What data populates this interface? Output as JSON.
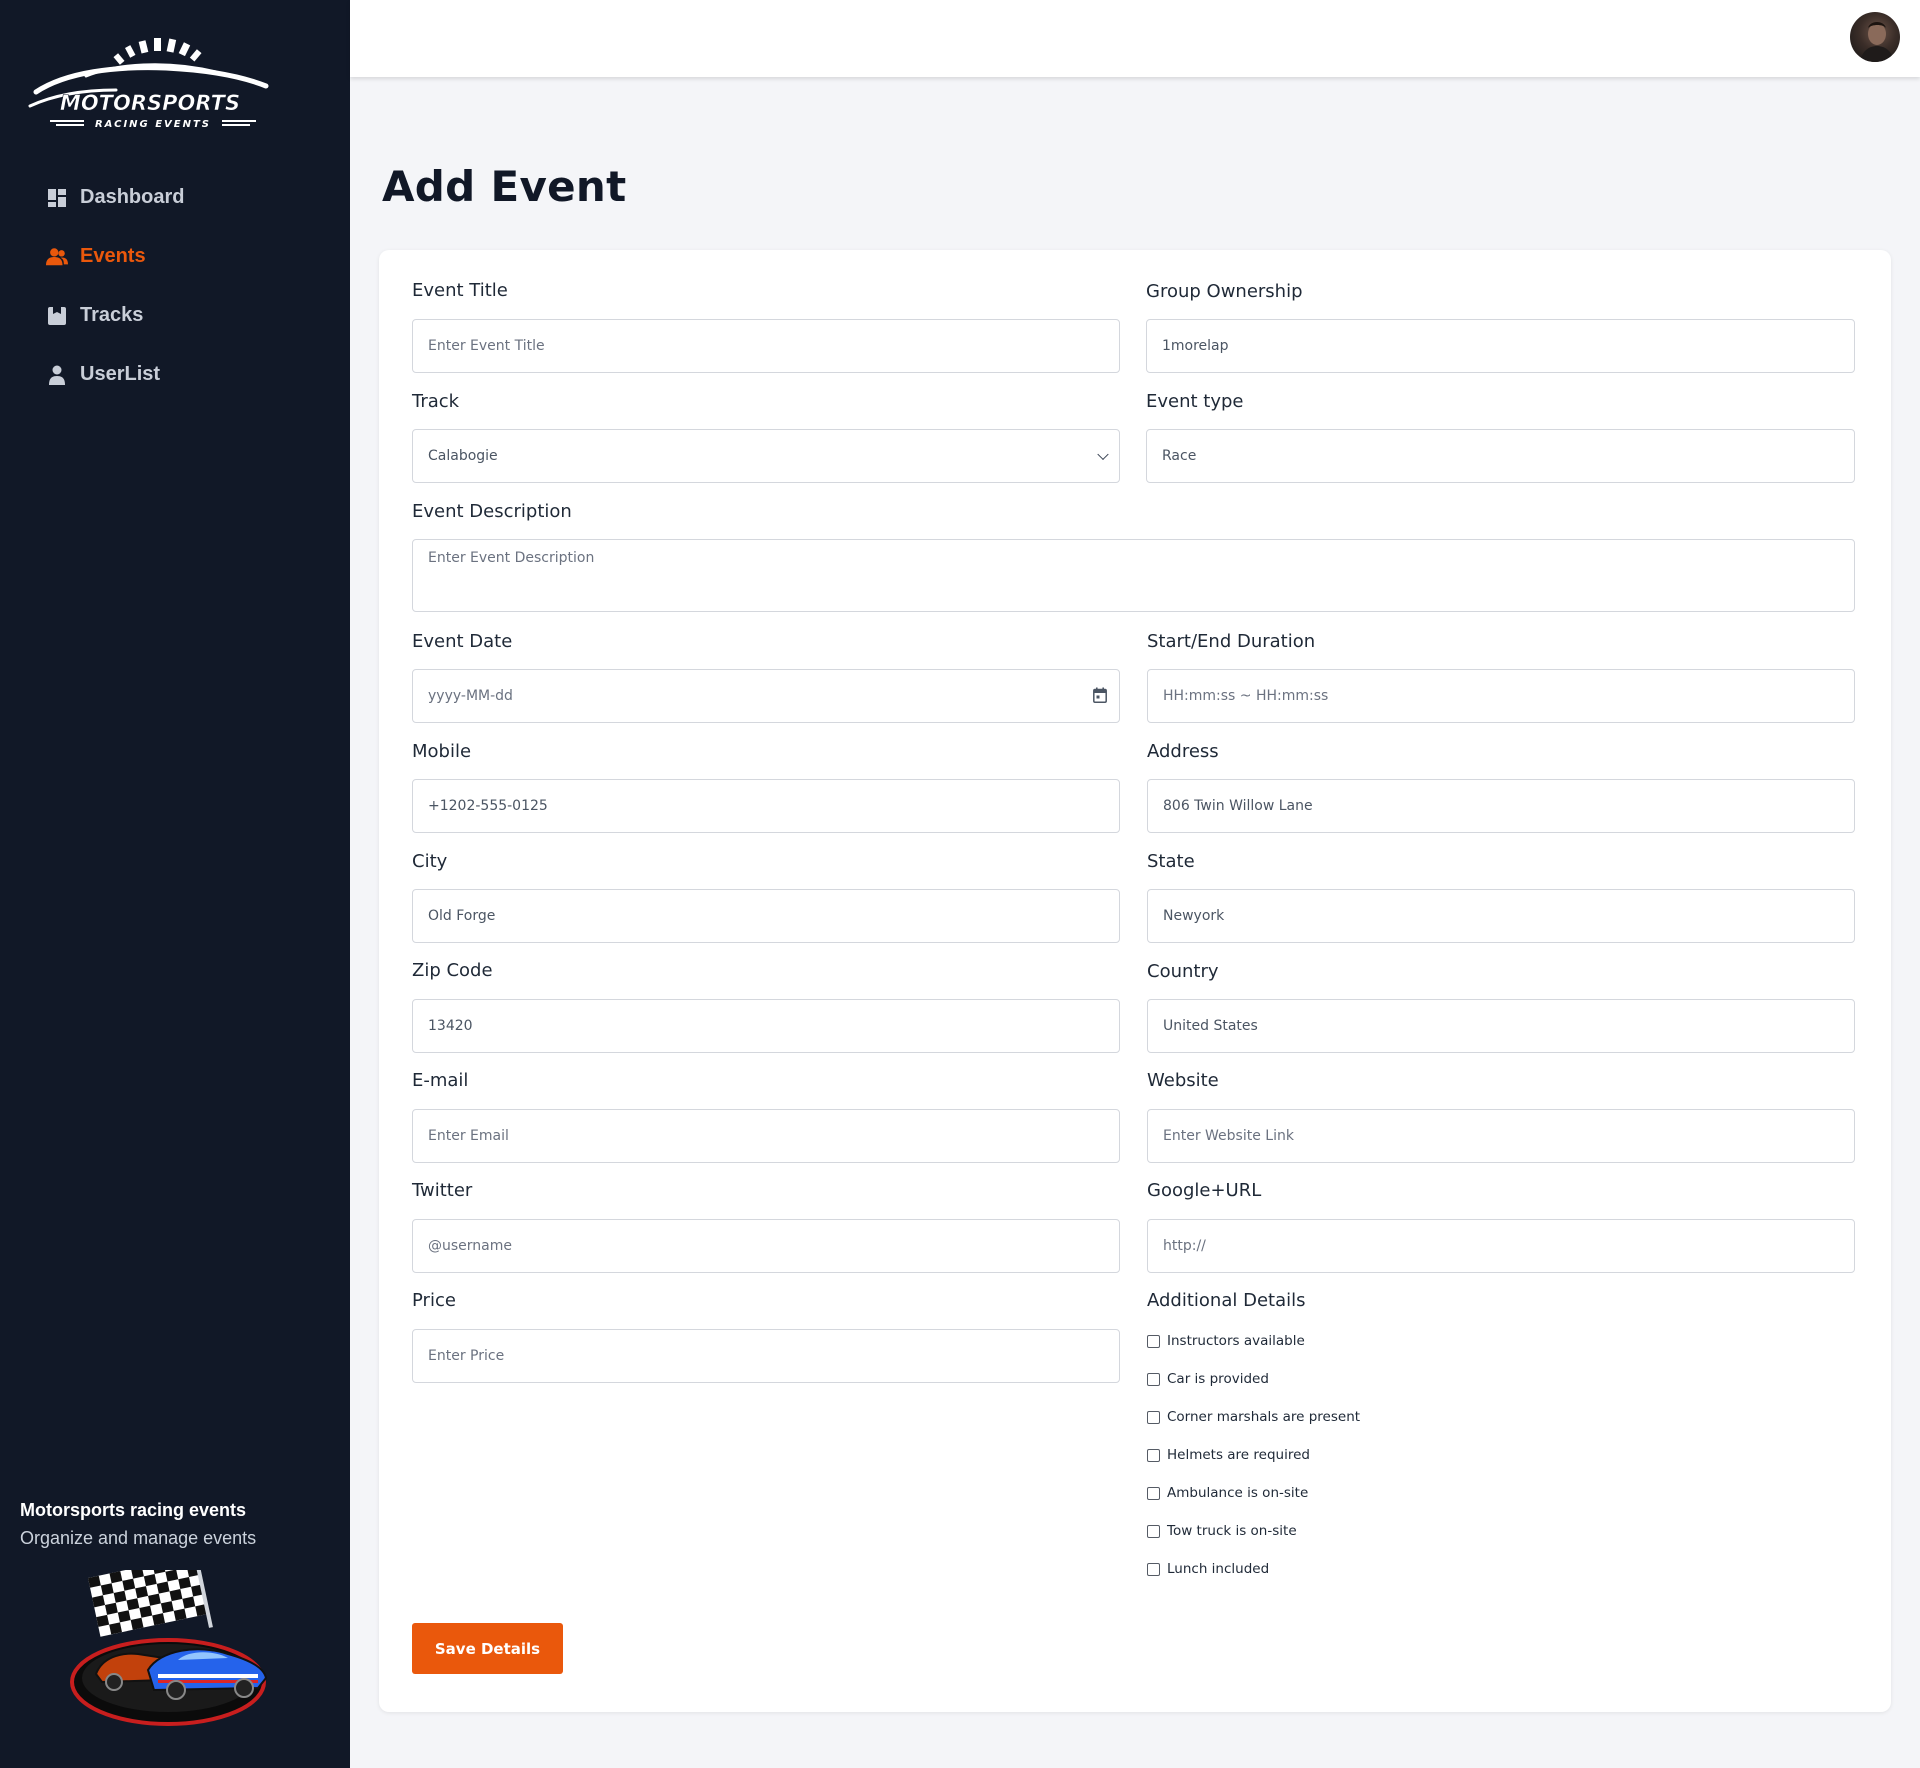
{
  "brand": {
    "logo_main": "MOTORSPORTS",
    "logo_sub": "RACING EVENTS",
    "title": "Motorsports racing events",
    "subtitle": "Organize and manage events"
  },
  "sidebar": {
    "items": [
      {
        "label": "Dashboard",
        "icon": "dashboard-icon",
        "active": false
      },
      {
        "label": "Events",
        "icon": "users-icon",
        "active": true
      },
      {
        "label": "Tracks",
        "icon": "tracks-icon",
        "active": false
      },
      {
        "label": "UserList",
        "icon": "user-icon",
        "active": false
      }
    ]
  },
  "page": {
    "title": "Add Event"
  },
  "form": {
    "event_title": {
      "label": "Event Title",
      "placeholder": "Enter Event Title"
    },
    "group_ownership": {
      "label": "Group Ownership",
      "value": "1morelap"
    },
    "track": {
      "label": "Track",
      "value": "Calabogie"
    },
    "event_type": {
      "label": "Event type",
      "value": "Race"
    },
    "event_description": {
      "label": "Event Description",
      "placeholder": "Enter Event Description"
    },
    "event_date": {
      "label": "Event Date",
      "placeholder": "yyyy-MM-dd"
    },
    "duration": {
      "label": "Start/End Duration",
      "placeholder": "HH:mm:ss ~ HH:mm:ss"
    },
    "mobile": {
      "label": "Mobile",
      "value": "+1202-555-0125"
    },
    "address": {
      "label": "Address",
      "value": "806 Twin Willow Lane"
    },
    "city": {
      "label": "City",
      "value": "Old Forge"
    },
    "state": {
      "label": "State",
      "value": "Newyork"
    },
    "zip": {
      "label": "Zip Code",
      "value": "13420"
    },
    "country": {
      "label": "Country",
      "value": "United States"
    },
    "email": {
      "label": "E-mail",
      "placeholder": "Enter Email"
    },
    "website": {
      "label": "Website",
      "placeholder": "Enter Website Link"
    },
    "twitter": {
      "label": "Twitter",
      "placeholder": "@username"
    },
    "google": {
      "label": "Google+URL",
      "placeholder": "http://"
    },
    "price": {
      "label": "Price",
      "placeholder": "Enter Price"
    },
    "additional": {
      "label": "Additional Details",
      "options": [
        {
          "label": "Instructors available",
          "checked": false
        },
        {
          "label": "Car is provided",
          "checked": false
        },
        {
          "label": "Corner marshals are present",
          "checked": false
        },
        {
          "label": "Helmets are required",
          "checked": false
        },
        {
          "label": "Ambulance is on-site",
          "checked": false
        },
        {
          "label": "Tow truck is on-site",
          "checked": false
        },
        {
          "label": "Lunch included",
          "checked": false
        }
      ]
    },
    "save_label": "Save Details"
  },
  "colors": {
    "accent": "#ea580c",
    "sidebar_bg": "#111827"
  }
}
